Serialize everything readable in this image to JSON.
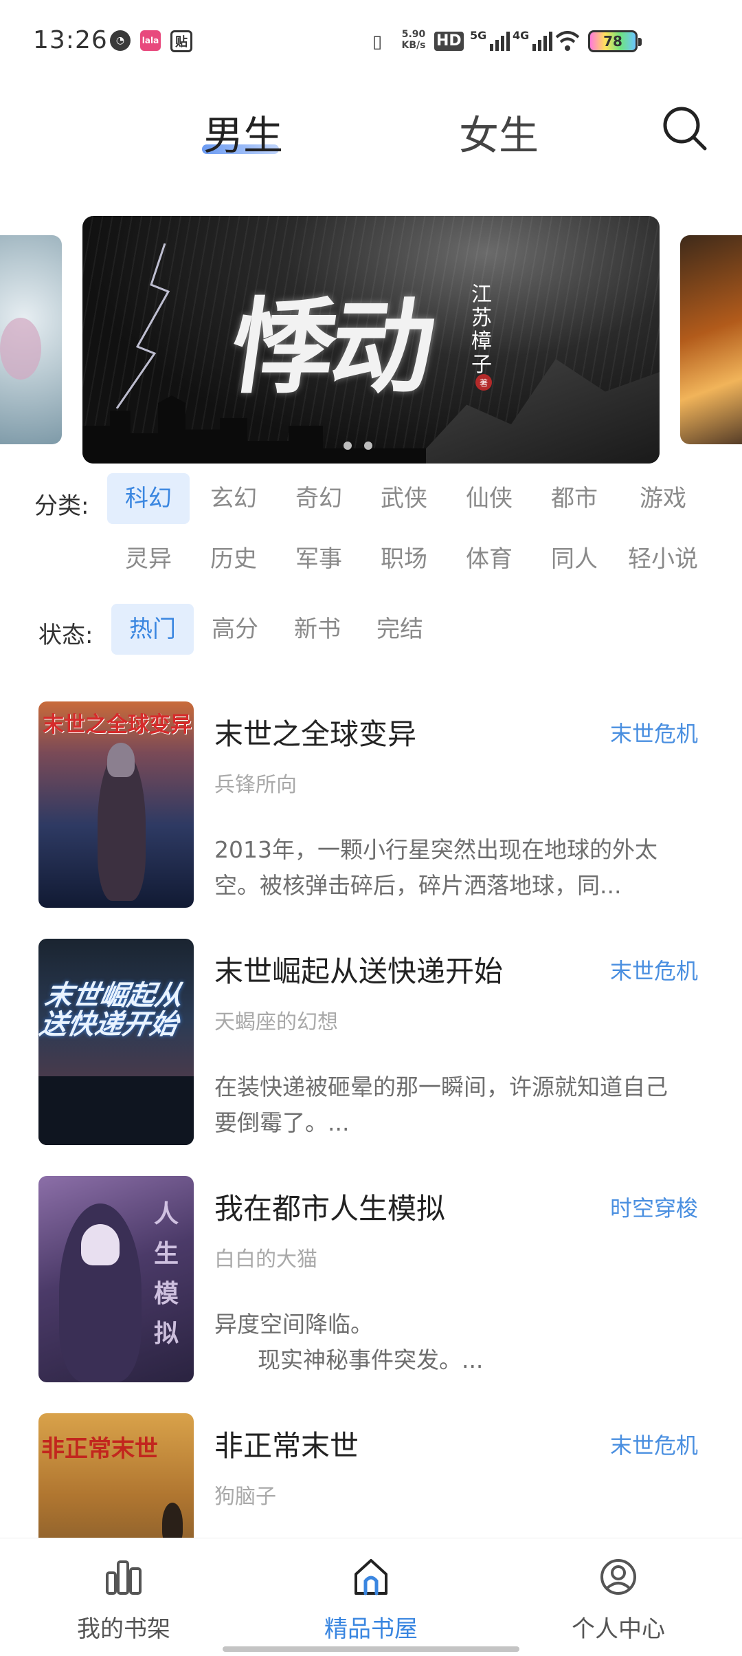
{
  "status_bar": {
    "time": "13:26",
    "net_speed": "5.90\nKB/s",
    "hd": "HD",
    "sig1": "5G",
    "sig2": "4G",
    "battery": "78"
  },
  "top_tabs": {
    "male": "男生",
    "female": "女生"
  },
  "banner": {
    "title": "悸动",
    "author": "江苏樟子",
    "seal": "著"
  },
  "filters": {
    "category_label": "分类:",
    "categories": [
      "科幻",
      "玄幻",
      "奇幻",
      "武侠",
      "仙侠",
      "都市",
      "游戏",
      "灵异",
      "历史",
      "军事",
      "职场",
      "体育",
      "同人",
      "轻小说"
    ],
    "status_label": "状态:",
    "statuses": [
      "热门",
      "高分",
      "新书",
      "完结"
    ]
  },
  "books": [
    {
      "title": "末世之全球变异",
      "tag": "末世危机",
      "author": "兵锋所向",
      "desc": "2013年，一颗小行星突然出现在地球的外太空。被核弹击碎后，碎片洒落地球，同...",
      "cover_text": "末世之全球变异"
    },
    {
      "title": "末世崛起从送快递开始",
      "tag": "末世危机",
      "author": "天蝎座的幻想",
      "desc": "在装快递被砸晕的那一瞬间，许源就知道自己要倒霉了。...",
      "cover_text": "末世崛起从送快递开始"
    },
    {
      "title": "我在都市人生模拟",
      "tag": "时空穿梭",
      "author": "白白的大猫",
      "desc": "异度空间降临。\n      现实神秘事件突发。...",
      "cover_text": "人生模拟"
    },
    {
      "title": "非正常末世",
      "tag": "末世危机",
      "author": "狗脑子",
      "desc": "",
      "cover_text": "非正常末世"
    }
  ],
  "bottom_nav": {
    "shelf": "我的书架",
    "store": "精品书屋",
    "profile": "个人中心"
  },
  "colors": {
    "accent": "#3a86e0",
    "chip_bg": "#e3eefd",
    "tag": "#4a8fe0"
  }
}
